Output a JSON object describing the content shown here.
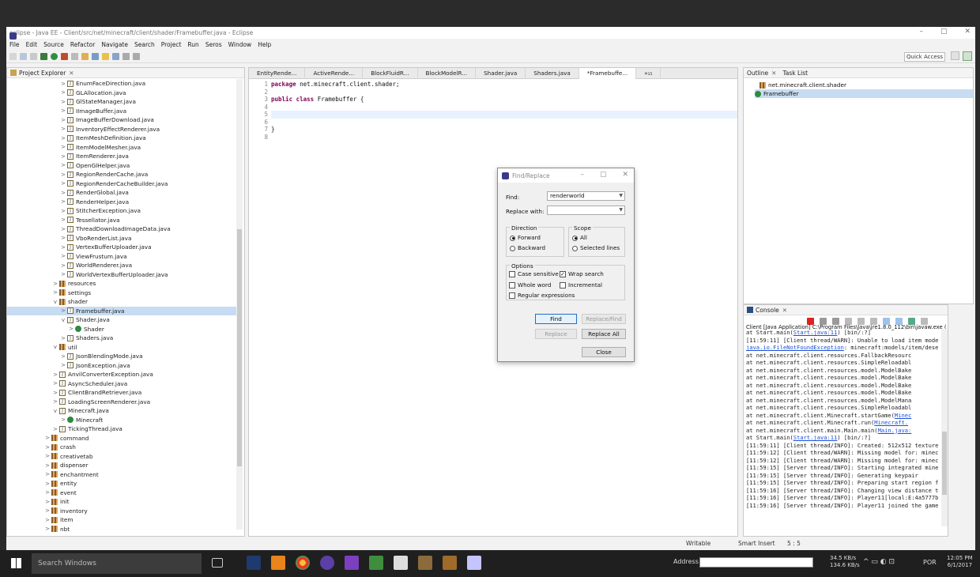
{
  "window": {
    "title": "eclipse - Java EE - Client/src/net/minecraft/client/shader/Framebuffer.java - Eclipse",
    "controls": [
      "–",
      "▢",
      "✕"
    ]
  },
  "menu": [
    "File",
    "Edit",
    "Source",
    "Refactor",
    "Navigate",
    "Search",
    "Project",
    "Run",
    "Seros",
    "Window",
    "Help"
  ],
  "quick_access": "Quick Access",
  "project_explorer": {
    "title": "Project Explorer",
    "rows": [
      {
        "indent": 7,
        "icon": "java",
        "label": "EnumFaceDirection.java",
        "arrow": ">"
      },
      {
        "indent": 7,
        "icon": "java",
        "label": "GLAllocation.java",
        "arrow": ">"
      },
      {
        "indent": 7,
        "icon": "java",
        "label": "GlStateManager.java",
        "arrow": ">"
      },
      {
        "indent": 7,
        "icon": "java",
        "label": "IImageBuffer.java",
        "arrow": ">"
      },
      {
        "indent": 7,
        "icon": "java",
        "label": "ImageBufferDownload.java",
        "arrow": ">"
      },
      {
        "indent": 7,
        "icon": "java",
        "label": "InventoryEffectRenderer.java",
        "arrow": ">"
      },
      {
        "indent": 7,
        "icon": "java",
        "label": "ItemMeshDefinition.java",
        "arrow": ">"
      },
      {
        "indent": 7,
        "icon": "java",
        "label": "ItemModelMesher.java",
        "arrow": ">"
      },
      {
        "indent": 7,
        "icon": "java",
        "label": "ItemRenderer.java",
        "arrow": ">"
      },
      {
        "indent": 7,
        "icon": "java",
        "label": "OpenGlHelper.java",
        "arrow": ">"
      },
      {
        "indent": 7,
        "icon": "java",
        "label": "RegionRenderCache.java",
        "arrow": ">"
      },
      {
        "indent": 7,
        "icon": "java",
        "label": "RegionRenderCacheBuilder.java",
        "arrow": ">"
      },
      {
        "indent": 7,
        "icon": "java",
        "label": "RenderGlobal.java",
        "arrow": ">"
      },
      {
        "indent": 7,
        "icon": "java",
        "label": "RenderHelper.java",
        "arrow": ">"
      },
      {
        "indent": 7,
        "icon": "java",
        "label": "StitcherException.java",
        "arrow": ">"
      },
      {
        "indent": 7,
        "icon": "java",
        "label": "Tessellator.java",
        "arrow": ">"
      },
      {
        "indent": 7,
        "icon": "java",
        "label": "ThreadDownloadImageData.java",
        "arrow": ">"
      },
      {
        "indent": 7,
        "icon": "java",
        "label": "VboRenderList.java",
        "arrow": ">"
      },
      {
        "indent": 7,
        "icon": "java",
        "label": "VertexBufferUploader.java",
        "arrow": ">"
      },
      {
        "indent": 7,
        "icon": "java",
        "label": "ViewFrustum.java",
        "arrow": ">"
      },
      {
        "indent": 7,
        "icon": "java",
        "label": "WorldRenderer.java",
        "arrow": ">"
      },
      {
        "indent": 7,
        "icon": "java",
        "label": "WorldVertexBufferUploader.java",
        "arrow": ">"
      },
      {
        "indent": 6,
        "icon": "pkg",
        "label": "resources",
        "arrow": ">"
      },
      {
        "indent": 6,
        "icon": "pkg",
        "label": "settings",
        "arrow": ">"
      },
      {
        "indent": 6,
        "icon": "pkg",
        "label": "shader",
        "arrow": "v"
      },
      {
        "indent": 7,
        "icon": "java",
        "label": "Framebuffer.java",
        "arrow": ">",
        "selected": true
      },
      {
        "indent": 7,
        "icon": "java",
        "label": "Shader.java",
        "arrow": "v"
      },
      {
        "indent": 8,
        "icon": "class",
        "label": "Shader",
        "arrow": ">"
      },
      {
        "indent": 7,
        "icon": "java",
        "label": "Shaders.java",
        "arrow": ">"
      },
      {
        "indent": 6,
        "icon": "pkg",
        "label": "util",
        "arrow": "v"
      },
      {
        "indent": 7,
        "icon": "java",
        "label": "JsonBlendingMode.java",
        "arrow": ">"
      },
      {
        "indent": 7,
        "icon": "java",
        "label": "JsonException.java",
        "arrow": ">"
      },
      {
        "indent": 6,
        "icon": "java",
        "label": "AnvilConverterException.java",
        "arrow": ">"
      },
      {
        "indent": 6,
        "icon": "java",
        "label": "AsyncScheduler.java",
        "arrow": ">"
      },
      {
        "indent": 6,
        "icon": "java",
        "label": "ClientBrandRetriever.java",
        "arrow": ">"
      },
      {
        "indent": 6,
        "icon": "java",
        "label": "LoadingScreenRenderer.java",
        "arrow": ">"
      },
      {
        "indent": 6,
        "icon": "java",
        "label": "Minecraft.java",
        "arrow": "v"
      },
      {
        "indent": 7,
        "icon": "class",
        "label": "Minecraft",
        "arrow": ">"
      },
      {
        "indent": 6,
        "icon": "java",
        "label": "TickingThread.java",
        "arrow": ">"
      },
      {
        "indent": 5,
        "icon": "pkg",
        "label": "command",
        "arrow": ">"
      },
      {
        "indent": 5,
        "icon": "pkg",
        "label": "crash",
        "arrow": ">"
      },
      {
        "indent": 5,
        "icon": "pkg",
        "label": "creativetab",
        "arrow": ">"
      },
      {
        "indent": 5,
        "icon": "pkg",
        "label": "dispenser",
        "arrow": ">"
      },
      {
        "indent": 5,
        "icon": "pkg",
        "label": "enchantment",
        "arrow": ">"
      },
      {
        "indent": 5,
        "icon": "pkg",
        "label": "entity",
        "arrow": ">"
      },
      {
        "indent": 5,
        "icon": "pkg",
        "label": "event",
        "arrow": ">"
      },
      {
        "indent": 5,
        "icon": "pkg",
        "label": "init",
        "arrow": ">"
      },
      {
        "indent": 5,
        "icon": "pkg",
        "label": "inventory",
        "arrow": ">"
      },
      {
        "indent": 5,
        "icon": "pkg",
        "label": "item",
        "arrow": ">"
      },
      {
        "indent": 5,
        "icon": "pkg",
        "label": "nbt",
        "arrow": ">"
      }
    ]
  },
  "editor": {
    "tabs": [
      "EntityRende...",
      "ActiveRende...",
      "BlockFluidR...",
      "BlockModelR...",
      "Shader.java",
      "Shaders.java",
      "*Framebuffe...",
      "»₁₅"
    ],
    "active_tab": 6,
    "lines": [
      {
        "num": "1",
        "kw": "package",
        "text": " net.minecraft.client.shader;"
      },
      {
        "num": "2",
        "kw": "",
        "text": ""
      },
      {
        "num": "3",
        "kw": "public class",
        "text": " Framebuffer {"
      },
      {
        "num": "4",
        "kw": "",
        "text": ""
      },
      {
        "num": "5",
        "kw": "",
        "text": "",
        "current": true
      },
      {
        "num": "6",
        "kw": "",
        "text": ""
      },
      {
        "num": "7",
        "kw": "",
        "text": "}"
      },
      {
        "num": "8",
        "kw": "",
        "text": ""
      }
    ]
  },
  "outline": {
    "tabs": [
      "Outline",
      "Task List"
    ],
    "items": [
      "net.minecraft.client.shader",
      "Framebuffer"
    ]
  },
  "console": {
    "title": "Console",
    "header": "Client [Java Application] C:\\Program Files\\Java\\jre1.8.0_112\\bin\\javaw.exe (Jun",
    "lines": [
      {
        "pre": "    at Start.main(",
        "link": "Start.java:11",
        "post": ") [bin/:?]"
      },
      {
        "pre": "[11:59:11] [Client thread/WARN]: Unable to load item mode",
        "link": "",
        "post": ""
      },
      {
        "pre": "",
        "link": "java.io.FileNotFoundException",
        "post": ": minecraft:models/item/dese"
      },
      {
        "pre": "    at net.minecraft.client.resources.FallbackResourc",
        "link": "",
        "post": ""
      },
      {
        "pre": "    at net.minecraft.client.resources.SimpleReloadabl",
        "link": "",
        "post": ""
      },
      {
        "pre": "    at net.minecraft.client.resources.model.ModelBake",
        "link": "",
        "post": ""
      },
      {
        "pre": "    at net.minecraft.client.resources.model.ModelBake",
        "link": "",
        "post": ""
      },
      {
        "pre": "    at net.minecraft.client.resources.model.ModelBake",
        "link": "",
        "post": ""
      },
      {
        "pre": "    at net.minecraft.client.resources.model.ModelBake",
        "link": "",
        "post": ""
      },
      {
        "pre": "    at net.minecraft.client.resources.model.ModelMana",
        "link": "",
        "post": ""
      },
      {
        "pre": "    at net.minecraft.client.resources.SimpleReloadabl",
        "link": "",
        "post": ""
      },
      {
        "pre": "    at net.minecraft.client.Minecraft.startGame(",
        "link": "Minec",
        "post": ""
      },
      {
        "pre": "    at net.minecraft.client.Minecraft.run(",
        "link": "Minecraft.",
        "post": ""
      },
      {
        "pre": "    at net.minecraft.client.main.Main.main(",
        "link": "Main.java:",
        "post": ""
      },
      {
        "pre": "    at Start.main(",
        "link": "Start.java:11",
        "post": ") [bin/:?]"
      },
      {
        "pre": "[11:59:11] [Client thread/INFO]: Created: 512x512 texture",
        "link": "",
        "post": ""
      },
      {
        "pre": "[11:59:12] [Client thread/WARN]: Missing model for: minec",
        "link": "",
        "post": ""
      },
      {
        "pre": "[11:59:12] [Client thread/WARN]: Missing model for: minec",
        "link": "",
        "post": ""
      },
      {
        "pre": "[11:59:15] [Server thread/INFO]: Starting integrated mine",
        "link": "",
        "post": ""
      },
      {
        "pre": "[11:59:15] [Server thread/INFO]: Generating keypair",
        "link": "",
        "post": ""
      },
      {
        "pre": "[11:59:15] [Server thread/INFO]: Preparing start region f",
        "link": "",
        "post": ""
      },
      {
        "pre": "[11:59:16] [Server thread/INFO]: Changing view distance t",
        "link": "",
        "post": ""
      },
      {
        "pre": "[11:59:16] [Server thread/INFO]: Player11[local:E:4a5777b",
        "link": "",
        "post": ""
      },
      {
        "pre": "[11:59:16] [Server thread/INFO]: Player11 joined the game",
        "link": "",
        "post": ""
      }
    ]
  },
  "find_replace": {
    "title": "Find/Replace",
    "find_label": "Find:",
    "find_value": "renderworld",
    "replace_label": "Replace with:",
    "replace_value": "",
    "direction_label": "Direction",
    "forward": "Forward",
    "backward": "Backward",
    "scope_label": "Scope",
    "all": "All",
    "selected_lines": "Selected lines",
    "options_label": "Options",
    "case_sensitive": "Case sensitive",
    "wrap_search": "Wrap search",
    "whole_word": "Whole word",
    "incremental": "Incremental",
    "regex": "Regular expressions",
    "btn_find": "Find",
    "btn_replace_find": "Replace/Find",
    "btn_replace": "Replace",
    "btn_replace_all": "Replace All",
    "btn_close": "Close"
  },
  "status": {
    "writable": "Writable",
    "insert": "Smart Insert",
    "position": "5 : 5"
  },
  "taskbar": {
    "search": "Search Windows",
    "address_label": "Address",
    "net_up": "34.5 KB/s",
    "net_down": "134.6 KB/s",
    "lang": "POR",
    "time": "12:05 PM",
    "date": "6/1/2017"
  }
}
